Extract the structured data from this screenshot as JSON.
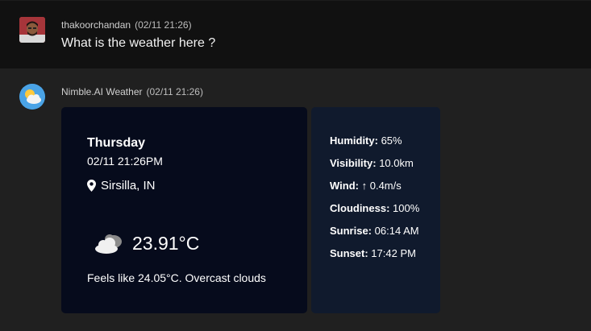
{
  "user_message": {
    "username": "thakoorchandan",
    "timestamp": "(02/11 21:26)",
    "text": "What is the weather here ?"
  },
  "bot_message": {
    "username": "Nimble.AI Weather",
    "timestamp": "(02/11 21:26)"
  },
  "weather": {
    "day": "Thursday",
    "datetime": "02/11 21:26PM",
    "location": "Sirsilla, IN",
    "temperature": "23.91°C",
    "description": "Feels like 24.05°C. Overcast clouds",
    "icon": "overcast-clouds-icon",
    "stats": {
      "humidity_label": "Humidity:",
      "humidity_value": "65%",
      "visibility_label": "Visibility:",
      "visibility_value": "10.0km",
      "wind_label": "Wind:",
      "wind_value": "↑ 0.4m/s",
      "cloudiness_label": "Cloudiness:",
      "cloudiness_value": "100%",
      "sunrise_label": "Sunrise:",
      "sunrise_value": "06:14 AM",
      "sunset_label": "Sunset:",
      "sunset_value": "17:42 PM"
    }
  },
  "colors": {
    "user_bg": "#111111",
    "bot_bg": "#202020",
    "card_main_bg": "#060b1c",
    "card_side_bg": "#101a2d"
  }
}
